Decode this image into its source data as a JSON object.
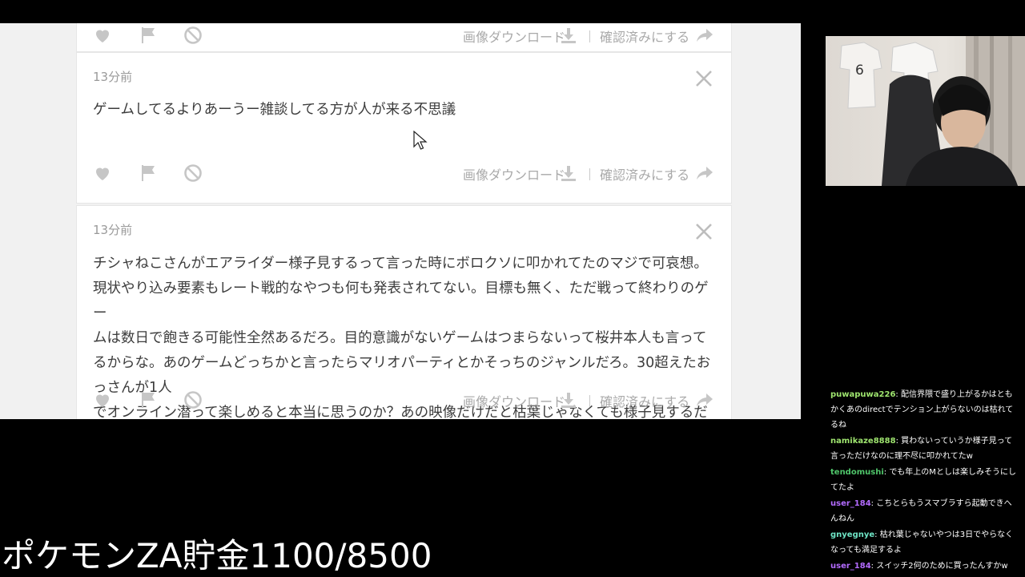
{
  "feed": {
    "cards": [
      {
        "time": "",
        "text": "",
        "download_label": "画像ダウンロード",
        "confirm_label": "確認済みにする"
      },
      {
        "time": "13分前",
        "text": "ゲームしてるよりあーうー雑談してる方が人が来る不思議",
        "download_label": "画像ダウンロード",
        "confirm_label": "確認済みにする"
      },
      {
        "time": "13分前",
        "text": "チシャねこさんがエアライダー様子見するって言った時にボロクソに叩かれてたのマジで可哀想。\n現状やり込み要素もレート戦的なやつも何も発表されてない。目標も無く、ただ戦って終わりのゲー\nムは数日で飽きる可能性全然あるだろ。目的意識がないゲームはつまらないって桜井本人も言って\nるからな。あのゲームどっちかと言ったらマリオパーティとかそっちのジャンルだろ。30超えたおっさんが1人\nでオンライン潜って楽しめると本当に思うのか？あの映像だけだと枯葉じゃなくても様子見するだろ。",
        "download_label": "画像ダウンロード",
        "confirm_label": "確認済みにする"
      }
    ]
  },
  "chat": [
    {
      "user": "puwapuwa226",
      "color": "#9fe56f",
      "message": "配信界隈で盛り上がるかはともかくあのdirectでテンション上がらないのは枯れてるね"
    },
    {
      "user": "namikaze8888",
      "color": "#9fe56f",
      "message": "買わないっていうか様子見って言っただけなのに理不尽に叩かれてたw"
    },
    {
      "user": "tendomushi",
      "color": "#4fc56a",
      "message": "でも年上のMとしは楽しみそうにしてたよ"
    },
    {
      "user": "user_184",
      "color": "#b36bff",
      "message": "こちとらもうスマブラすら起動できへんねん"
    },
    {
      "user": "gnyegnye",
      "color": "#6fe5c6",
      "message": "枯れ葉じゃないやつは3日でやらなくなっても満足するよ"
    },
    {
      "user": "user_184",
      "color": "#b36bff",
      "message": "スイッチ2何のために買ったんすかw"
    }
  ],
  "overlay": {
    "goal_text": "ポケモンZA貯金1100/8500"
  },
  "colors": {
    "icon_gray": "#c6c6c6",
    "text_gray": "#a9a9a9",
    "card_bg": "#ffffff",
    "page_bg": "#f1f1f1"
  }
}
